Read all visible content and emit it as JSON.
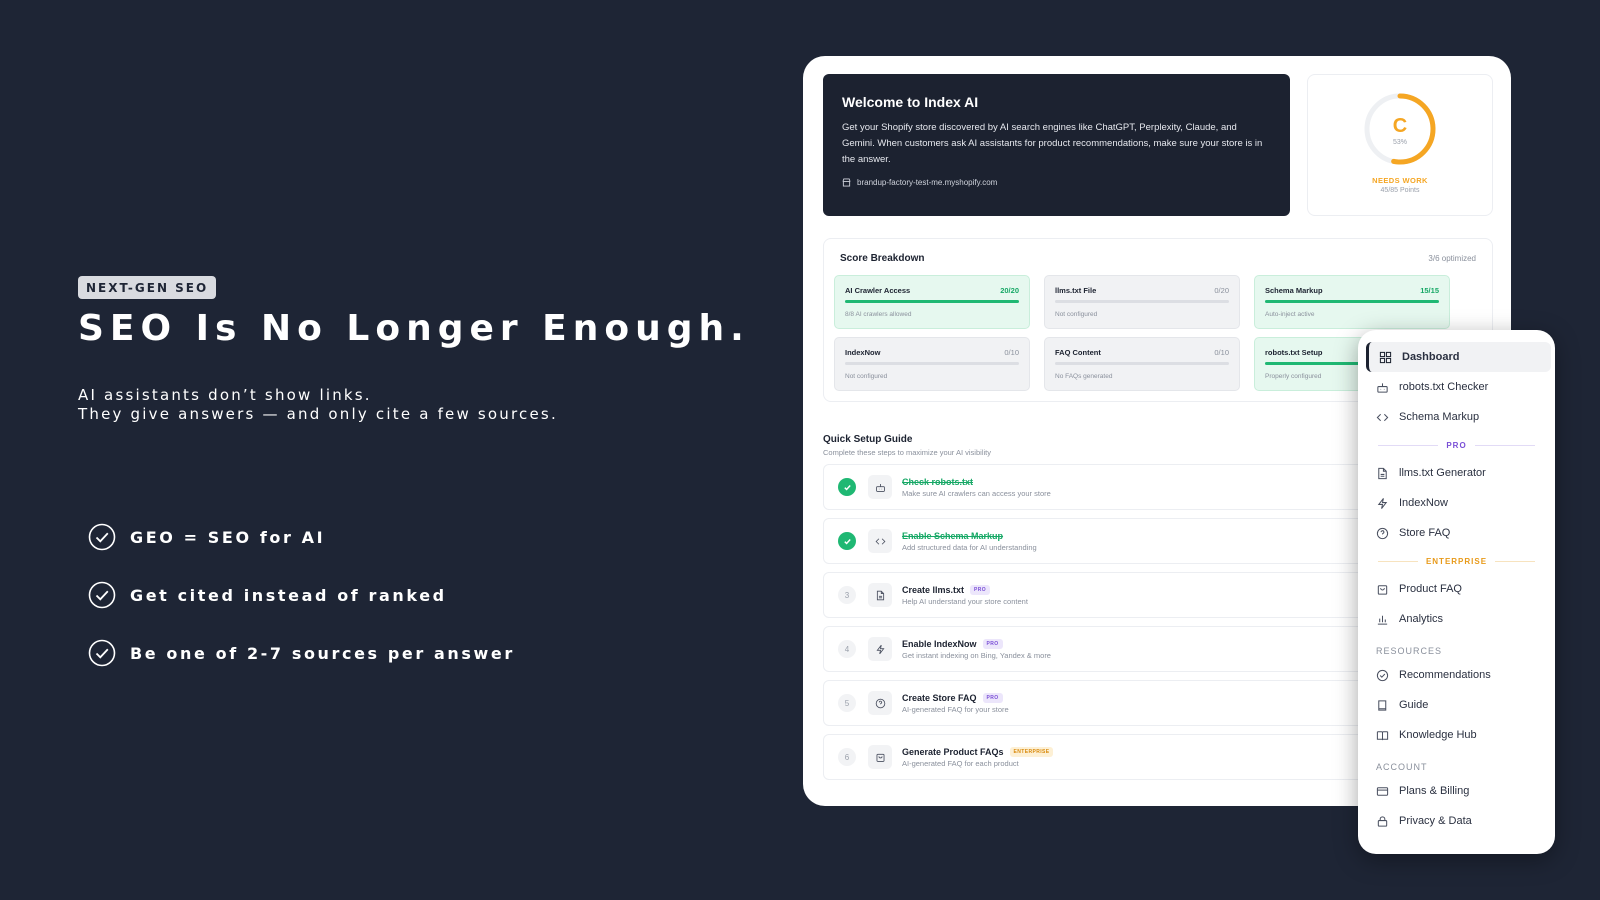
{
  "marketing": {
    "badge": "NEXT-GEN SEO",
    "headline": "SEO Is No Longer Enough.",
    "sub_line1": "AI assistants don’t show links.",
    "sub_line2": "They give answers — and only cite a few sources.",
    "bullets": [
      "GEO = SEO for AI",
      "Get cited instead of ranked",
      "Be one of 2-7 sources per answer"
    ]
  },
  "welcome": {
    "title": "Welcome to Index AI",
    "body": "Get your Shopify store discovered by AI search engines like ChatGPT, Perplexity, Claude, and Gemini. When customers ask AI assistants for product recommendations, make sure your store is in the answer.",
    "store_url": "brandup-factory-test-me.myshopify.com"
  },
  "score": {
    "grade": "C",
    "percent_label": "53%",
    "percent": 0.53,
    "status": "NEEDS WORK",
    "points": "45/85 Points",
    "color": "#f5a623"
  },
  "breakdown": {
    "title": "Score Breakdown",
    "optimized": "3/6 optimized",
    "metrics": [
      {
        "name": "AI Crawler Access",
        "score": "20/20",
        "sub": "8/8 AI crawlers allowed",
        "status": "good"
      },
      {
        "name": "llms.txt File",
        "score": "0/20",
        "sub": "Not configured",
        "status": "bad"
      },
      {
        "name": "Schema Markup",
        "score": "15/15",
        "sub": "Auto-inject active",
        "status": "good"
      },
      {
        "name": "IndexNow",
        "score": "0/10",
        "sub": "Not configured",
        "status": "bad"
      },
      {
        "name": "FAQ Content",
        "score": "0/10",
        "sub": "No FAQs generated",
        "status": "bad"
      },
      {
        "name": "robots.txt Setup",
        "score": "",
        "sub": "Properly configured",
        "status": "good"
      }
    ]
  },
  "quick_setup": {
    "title": "Quick Setup Guide",
    "subtitle": "Complete these steps to maximize your AI visibility",
    "steps": [
      {
        "num": "",
        "title": "Check robots.txt",
        "desc": "Make sure AI crawlers can access your store",
        "done": true,
        "tag": "",
        "icon": "robot-icon"
      },
      {
        "num": "",
        "title": "Enable Schema Markup",
        "desc": "Add structured data for AI understanding",
        "done": true,
        "tag": "",
        "icon": "code-icon"
      },
      {
        "num": "3",
        "title": "Create llms.txt",
        "desc": "Help AI understand your store content",
        "done": false,
        "tag": "PRO",
        "icon": "file-icon"
      },
      {
        "num": "4",
        "title": "Enable IndexNow",
        "desc": "Get instant indexing on Bing, Yandex & more",
        "done": false,
        "tag": "PRO",
        "icon": "bolt-icon"
      },
      {
        "num": "5",
        "title": "Create Store FAQ",
        "desc": "AI-generated FAQ for your store",
        "done": false,
        "tag": "PRO",
        "icon": "help-icon"
      },
      {
        "num": "6",
        "title": "Generate Product FAQs",
        "desc": "AI-generated FAQ for each product",
        "done": false,
        "tag": "ENTERPRISE",
        "icon": "bag-icon"
      }
    ]
  },
  "sidebar": {
    "items_main": [
      {
        "label": "Dashboard",
        "icon": "grid-icon",
        "active": true
      },
      {
        "label": "robots.txt Checker",
        "icon": "robot-icon"
      },
      {
        "label": "Schema Markup",
        "icon": "code-icon"
      }
    ],
    "pro_label": "PRO",
    "items_pro": [
      {
        "label": "llms.txt Generator",
        "icon": "file-icon"
      },
      {
        "label": "IndexNow",
        "icon": "bolt-icon"
      },
      {
        "label": "Store FAQ",
        "icon": "help-icon"
      }
    ],
    "enterprise_label": "ENTERPRISE",
    "items_ent": [
      {
        "label": "Product FAQ",
        "icon": "bag-icon"
      },
      {
        "label": "Analytics",
        "icon": "chart-icon"
      }
    ],
    "resources_label": "RESOURCES",
    "items_res": [
      {
        "label": "Recommendations",
        "icon": "check-circle-icon"
      },
      {
        "label": "Guide",
        "icon": "book-icon"
      },
      {
        "label": "Knowledge Hub",
        "icon": "open-book-icon"
      }
    ],
    "account_label": "ACCOUNT",
    "items_acc": [
      {
        "label": "Plans & Billing",
        "icon": "card-icon"
      },
      {
        "label": "Privacy & Data",
        "icon": "lock-icon"
      }
    ]
  }
}
